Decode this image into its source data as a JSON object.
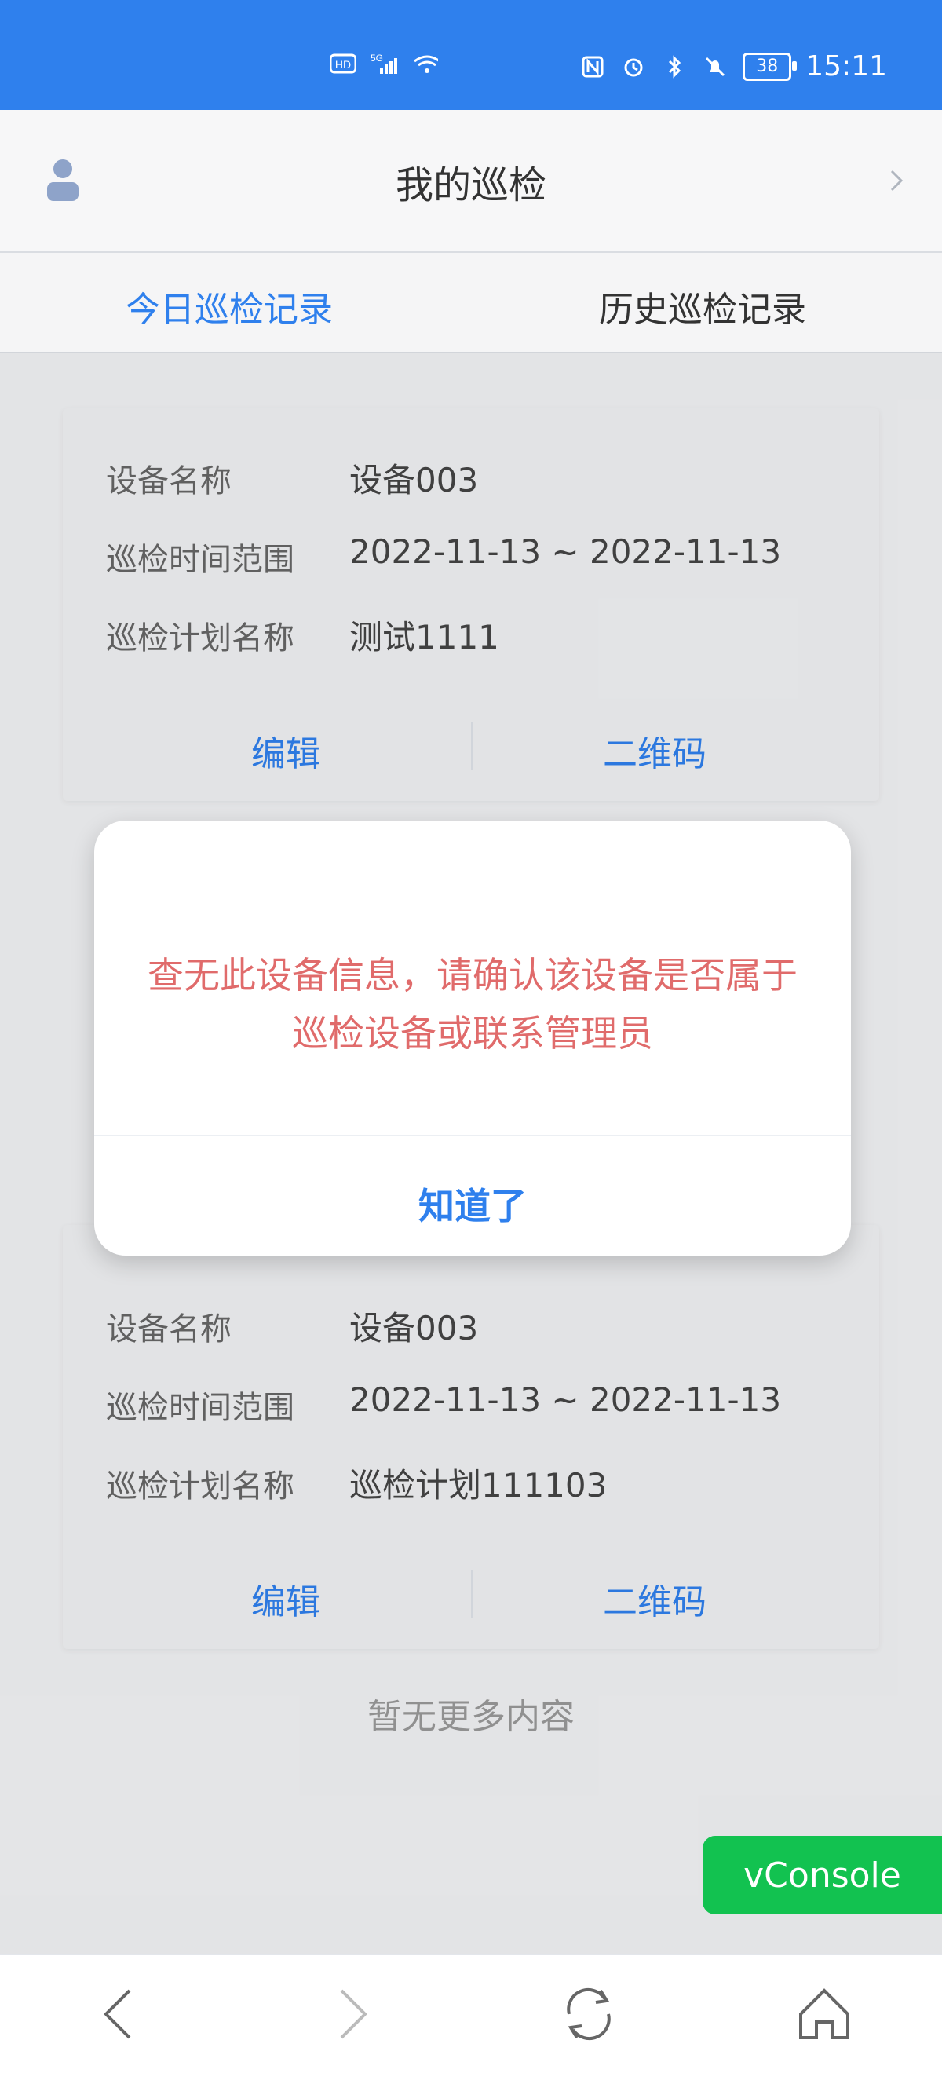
{
  "status_bar": {
    "time": "15:11",
    "battery": "38",
    "icons": [
      "hd-icon",
      "5g-icon",
      "signal-icon",
      "wifi-icon",
      "nfc-icon",
      "alarm-icon",
      "bluetooth-icon",
      "mute-icon",
      "battery-icon"
    ],
    "bg_color": "#2f80ed"
  },
  "header": {
    "title": "我的巡检",
    "left_icon": "user-icon",
    "right_icon": "chevron-right-icon"
  },
  "tabs": [
    {
      "label": "今日巡检记录",
      "active": true
    },
    {
      "label": "历史巡检记录",
      "active": false
    }
  ],
  "records": [
    {
      "device_label": "设备名称",
      "device_value": "设备003",
      "time_label": "巡检时间范围",
      "time_value": "2022-11-13 ~ 2022-11-13",
      "plan_label": "巡检计划名称",
      "plan_value": "测试1111",
      "edit_label": "编辑",
      "qrcode_label": "二维码"
    },
    {
      "device_label": "设备名称",
      "device_value": "设备003",
      "time_label": "巡检时间范围",
      "time_value": "2022-11-13 ~ 2022-11-13",
      "plan_label": "巡检计划名称",
      "plan_value": "巡检计划111103",
      "edit_label": "编辑",
      "qrcode_label": "二维码"
    }
  ],
  "modal": {
    "message_line1": "查无此设备信息，请确认该设备是否属于",
    "message_line2": "巡检设备或联系管理员",
    "ok_label": "知道了",
    "message_color": "#e06b6b"
  },
  "footer": {
    "no_more": "暂无更多内容"
  },
  "vconsole": {
    "label": "vConsole",
    "color": "#12c250"
  },
  "bottom_nav": {
    "icons": [
      "back-icon",
      "forward-icon",
      "refresh-icon",
      "home-icon"
    ]
  },
  "accent_color": "#2f80ed"
}
